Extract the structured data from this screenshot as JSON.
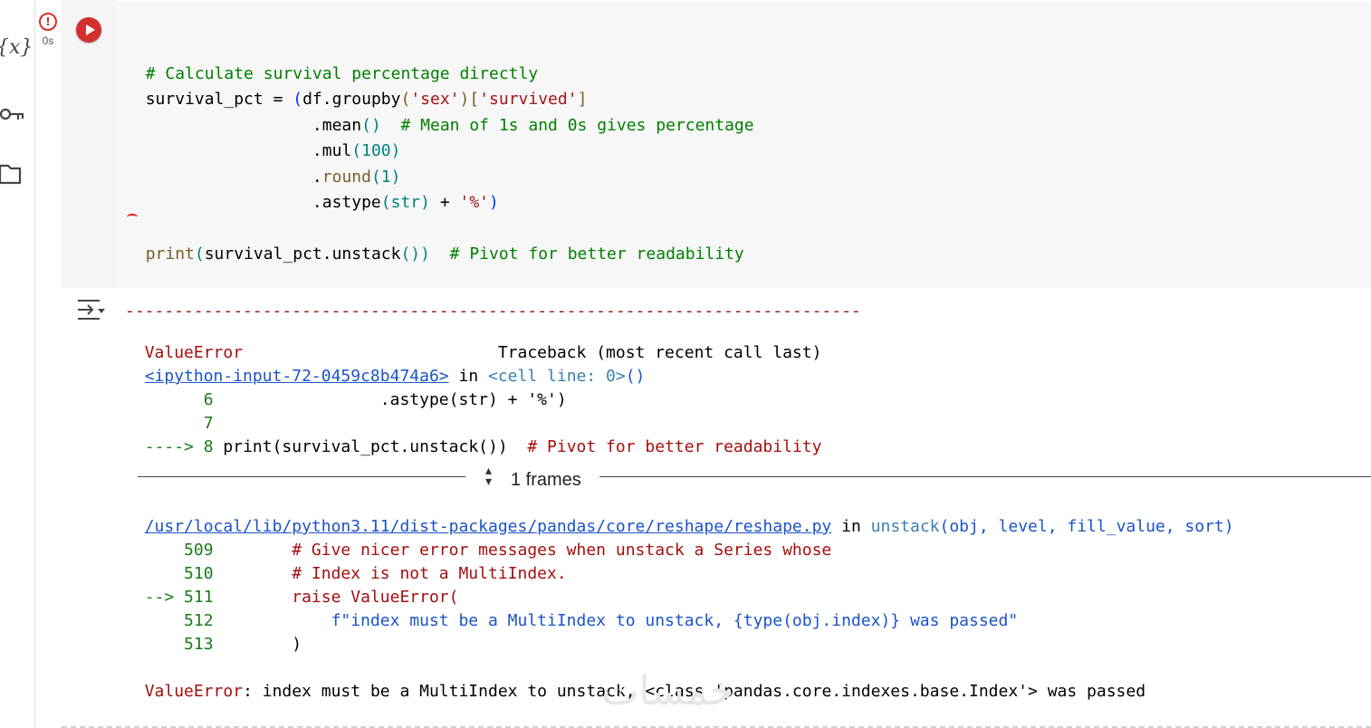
{
  "sidebar": {
    "icons": [
      "variables-icon",
      "key-icon",
      "folder-icon"
    ],
    "variables_label": "{x}"
  },
  "cell": {
    "status_time": "0s",
    "code": {
      "l1": "# Calculate survival percentage directly",
      "l2_a": "survival_pct = ",
      "l2_b": "(",
      "l2_c": "df.groupby",
      "l2_d": "(",
      "l2_e": "'sex'",
      "l2_f": ")[",
      "l2_g": "'survived'",
      "l2_h": "]",
      "l3_a": "                 .mean",
      "l3_b": "()",
      "l3_c": "  # Mean of 1s and 0s gives percentage",
      "l4_a": "                 .mul",
      "l4_b": "(100)",
      "l5_a": "                 .",
      "l5_b": "round",
      "l5_c": "(1)",
      "l6_a": "                 .astype",
      "l6_b": "(",
      "l6_c": "str",
      "l6_d": ")",
      "l6_e": " + ",
      "l6_f": "'%'",
      "l6_g": ")",
      "l7_a": "print",
      "l7_b": "(",
      "l7_c": "survival_pct.unstack",
      "l7_d": "())",
      "l7_e": "  # Pivot for better readability"
    }
  },
  "output": {
    "dashes": "---------------------------------------------------------------------------",
    "err_name": "ValueError",
    "traceback_header": "Traceback (most recent call last)",
    "input_link": "<ipython-input-72-0459c8b474a6>",
    "in_word": " in ",
    "cell_line": "<cell line: 0>",
    "cell_parens": "()",
    "f1_l6_num": "      6",
    "f1_l6_code": "                 .astype(str) + '%')",
    "f1_l7_num": "      7",
    "f1_arrow": "----> 8 ",
    "f1_l8_code": "print(survival_pct.unstack())",
    "f1_l8_com": "  # Pivot for better readability",
    "frames_label": "1 frames",
    "file_link": "/usr/local/lib/python3.11/dist-packages/pandas/core/reshape/reshape.py",
    "func_name": "unstack",
    "func_args": "(obj, level, fill_value, sort)",
    "f2_509_num": "    509",
    "f2_509_code": "        # Give nicer error messages when unstack a Series whose",
    "f2_510_num": "    510",
    "f2_510_code": "        # Index is not a MultiIndex.",
    "f2_511_arrow": "--> 511",
    "f2_511_code": "        raise ValueError(",
    "f2_512_num": "    512",
    "f2_512_code": "            f\"index must be a MultiIndex to unstack, {type(obj.index)} was passed\"",
    "f2_513_num": "    513",
    "f2_513_code": "        )",
    "final_err_name": "ValueError",
    "final_err_msg": ": index must be a MultiIndex to unstack, <class 'pandas.core.indexes.base.Index'> was passed"
  },
  "watermark": "خمسات"
}
